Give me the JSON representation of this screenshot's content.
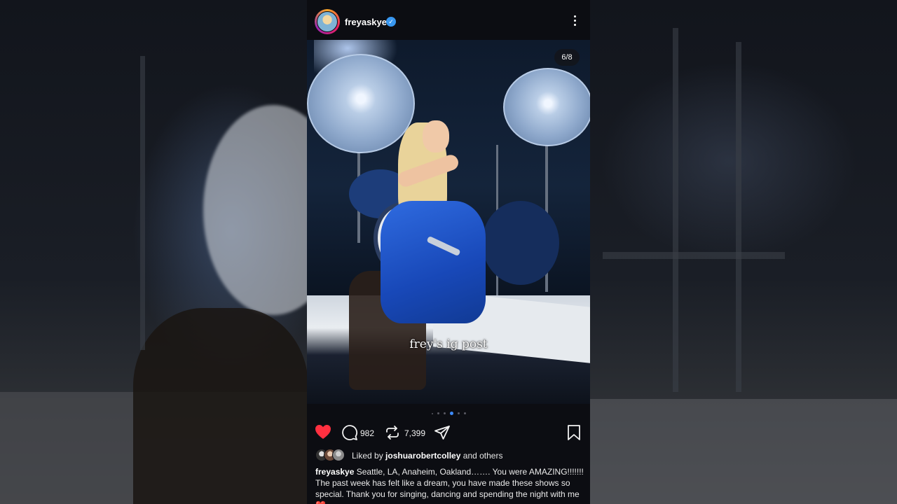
{
  "post": {
    "username": "freyaskye",
    "verified": true,
    "slide_counter": "6/8",
    "overlay_caption": "frey's ig post",
    "carousel": {
      "total": 8,
      "active": 6
    },
    "likes_display": "Liked by",
    "liked_by_user": "joshuarobertcolley",
    "liked_by_suffix": "and others",
    "comment_count": "982",
    "repost_count": "7,399",
    "caption_username": "freyaskye",
    "caption_text": "Seattle, LA, Anaheim, Oakland……. You were AMAZING!!!!!!! The past week has felt like a dream, you have made these shows so special. Thank you for singing, dancing and spending the night with me❤️"
  },
  "icons": {
    "header": [
      "verified-badge-icon",
      "more-options-icon"
    ],
    "actions": [
      "heart-icon",
      "comment-icon",
      "repost-icon",
      "share-icon",
      "bookmark-icon"
    ]
  },
  "colors": {
    "like_red": "#ff3040",
    "verified_blue": "#3897f0",
    "panel_bg": "#0c0d12",
    "active_dot": "#3d8bfd"
  }
}
